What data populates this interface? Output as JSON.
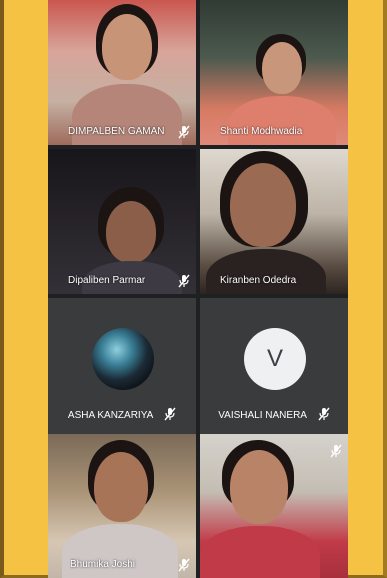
{
  "meeting": {
    "participants": [
      {
        "name": "DIMPALBEN GAMAN",
        "muted": true
      },
      {
        "name": "Shanti Modhwadia",
        "muted": false
      },
      {
        "name": "Dipaliben Parmar",
        "muted": true
      },
      {
        "name": "Kiranben Odedra",
        "muted": false
      },
      {
        "name": "ASHA KANZARIYA",
        "muted": true,
        "avatar": "photo"
      },
      {
        "name": "VAISHALI NANERA",
        "muted": true,
        "avatar_letter": "V"
      },
      {
        "name": "Bhumika Joshi",
        "muted": true
      },
      {
        "name": "",
        "muted": true
      }
    ]
  },
  "colors": {
    "frame_background": "#f6c244",
    "tile_background": "#2b2c2e",
    "label_text": "#ffffff"
  },
  "icons": {
    "muted": "mic-off-icon"
  }
}
